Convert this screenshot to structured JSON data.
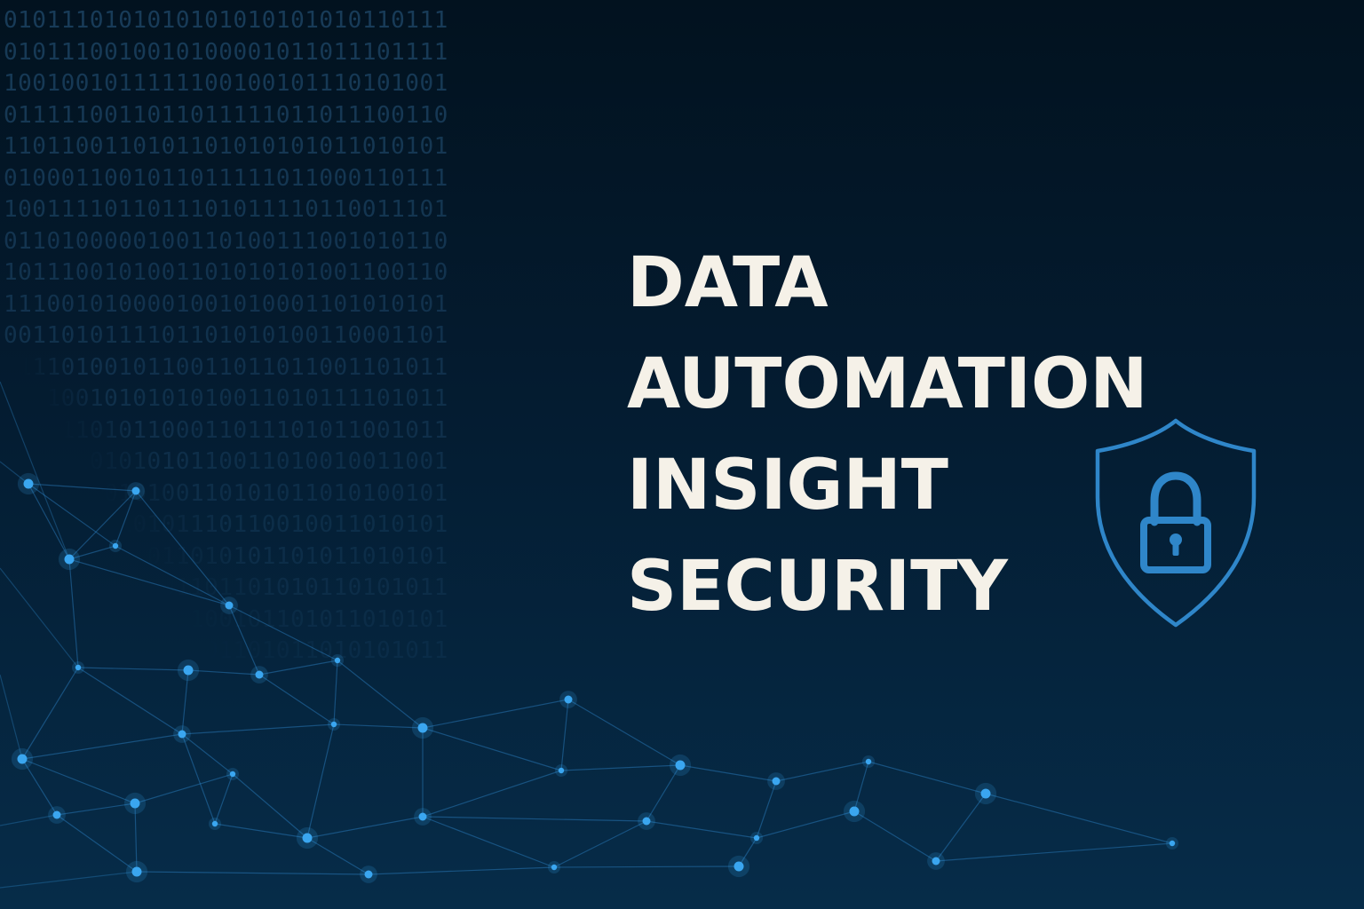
{
  "headline": {
    "words": [
      "DATA",
      "AUTOMATION",
      "INSIGHT",
      "SECURITY"
    ]
  },
  "binary_pattern": [
    "0101110101010101010101010110111",
    "0101110010010100001011011101111",
    "1001001011111100100101110101001",
    "0111110011011011111011011100110",
    "1101100110101101010101011010101",
    "0100011001011011111011000110111",
    "1001111011011101011110110011101",
    "0110100000100110100111001010110",
    "1011100101001101010101001100110",
    "1110010100001001010001101010101",
    "0011010111101101010100110001101",
    "1111010010110011011011001101011",
    "0101001010101010011010111101011",
    "0100110101100011011101011001011",
    "0111010101010110011010010011001",
    "1101101010100110101011010100101",
    "1010011010101110110010011010101",
    "1111010101011010101101011010101",
    "0010010110101101101010110101011",
    "0111011100100100101101011010101",
    "0010110010101101101011010101011"
  ],
  "colors": {
    "background_top": "#02121f",
    "background_bottom": "#062c49",
    "headline": "#f5f1e8",
    "accent_blue": "#2f86c9",
    "node_blue": "#3aa6f0",
    "binary": "#2a5d86"
  },
  "icons": {
    "shield": "shield-lock-icon"
  }
}
